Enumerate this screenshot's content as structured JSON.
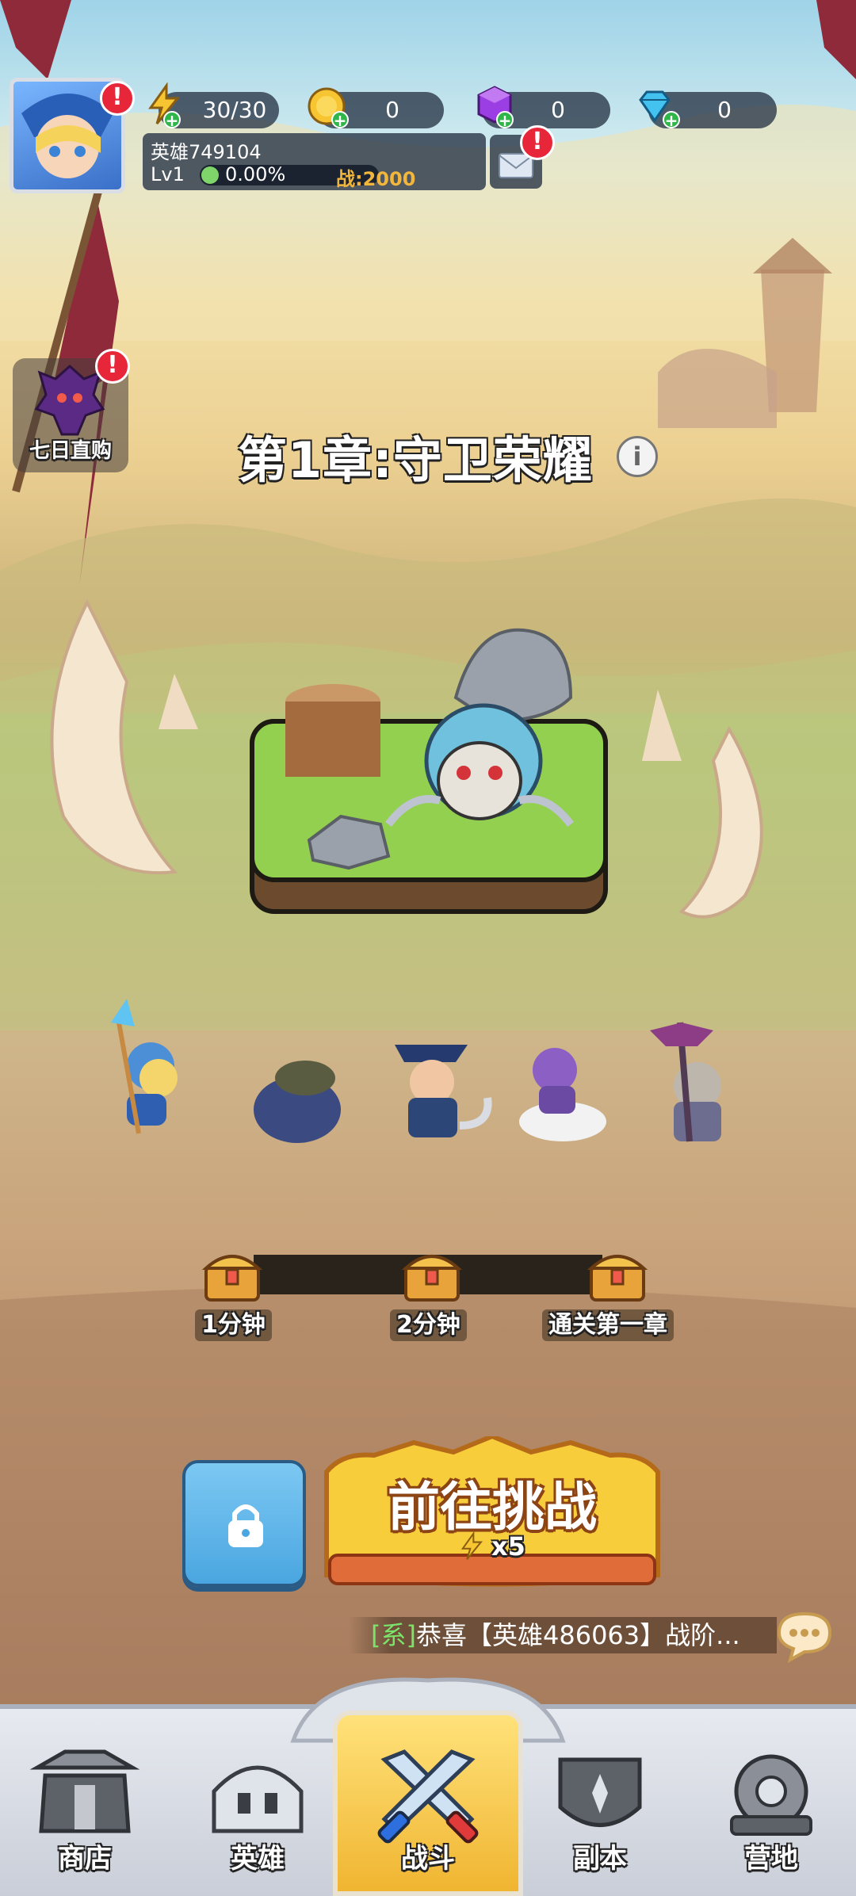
{
  "player": {
    "name": "英雄749104",
    "level": "Lv1",
    "exp_percent": "0.00%",
    "power": "战:2000"
  },
  "resources": {
    "stamina": "30/30",
    "gold": "0",
    "gem_purple": "0",
    "diamond": "0"
  },
  "badges": {
    "alert": "!"
  },
  "event": {
    "seven_day_label": "七日直购"
  },
  "chapter": {
    "title": "第1章:守卫荣耀",
    "info": "i"
  },
  "progress": {
    "fill_fraction": 0,
    "milestones": [
      {
        "label": "1分钟"
      },
      {
        "label": "2分钟"
      },
      {
        "label": "通关第一章"
      }
    ]
  },
  "actions": {
    "challenge_label": "前往挑战",
    "challenge_cost": "x5"
  },
  "chat": {
    "sys_tag": "[系]",
    "message": "恭喜【英雄486063】战阶..."
  },
  "nav": {
    "items": [
      {
        "label": "商店"
      },
      {
        "label": "英雄"
      },
      {
        "label": "战斗"
      },
      {
        "label": "副本"
      },
      {
        "label": "营地"
      }
    ],
    "active": "战斗"
  },
  "colors": {
    "alert": "#e7263a",
    "accent_yellow": "#f0b531",
    "chat_system": "#7de36a"
  }
}
